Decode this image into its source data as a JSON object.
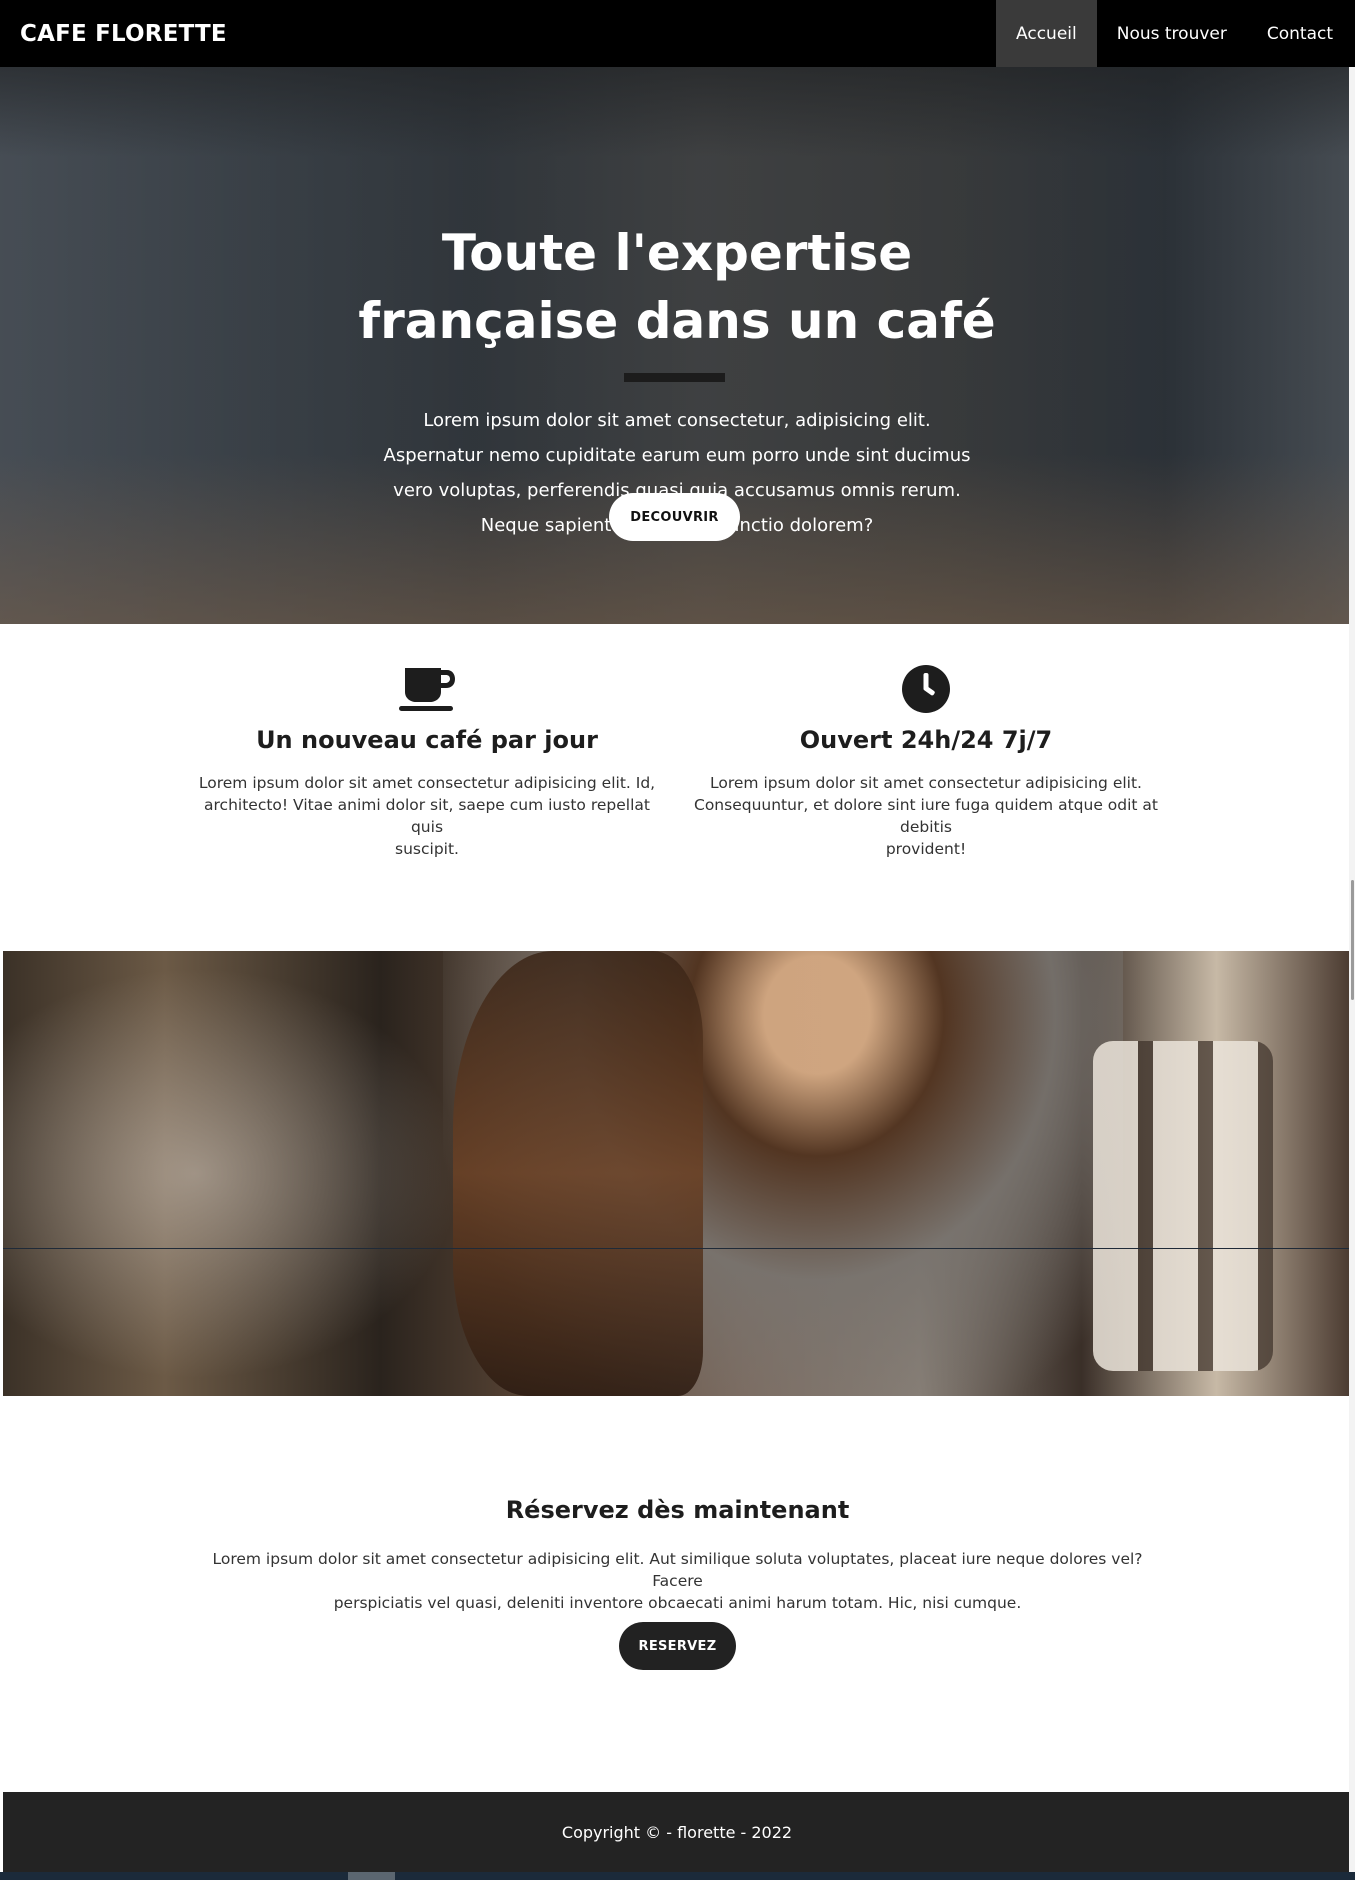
{
  "navbar": {
    "brand": "CAFE FLORETTE",
    "links": [
      {
        "label": "Accueil",
        "active": true
      },
      {
        "label": "Nous trouver",
        "active": false
      },
      {
        "label": "Contact",
        "active": false
      }
    ],
    "background": "#000000",
    "active_background": "#3a3a3a"
  },
  "hero": {
    "title_line1": "Toute l'expertise",
    "title_line2": "française dans un café",
    "text_lines": [
      "Lorem ipsum dolor sit amet consectetur, adipisicing elit.",
      "Aspernatur nemo cupiditate earum eum porro unde sint ducimus",
      "vero voluptas, perferendis quasi quia accusamus omnis rerum.",
      "Neque sapiente quidem distinctio dolorem?"
    ],
    "button_label": "DECOUVRIR"
  },
  "features": [
    {
      "icon": "coffee-cup-icon",
      "title": "Un nouveau café par jour",
      "text_lines": [
        "Lorem ipsum dolor sit amet consectetur adipisicing elit. Id,",
        "architecto! Vitae animi dolor sit, saepe cum iusto repellat quis",
        "suscipit."
      ]
    },
    {
      "icon": "clock-icon",
      "title": "Ouvert 24h/24 7j/7",
      "text_lines": [
        "Lorem ipsum dolor sit amet consectetur adipisicing elit.",
        "Consequuntur, et dolore sint iure fuga quidem atque odit at debitis",
        "provident!"
      ]
    }
  ],
  "reservation": {
    "title": "Réservez dès maintenant",
    "text_lines": [
      "Lorem ipsum dolor sit amet consectetur adipisicing elit. Aut similique soluta voluptates, placeat iure neque dolores vel? Facere",
      "perspiciatis vel quasi, deleniti inventore obcaecati animi harum totam. Hic, nisi cumque."
    ],
    "button_label": "RESERVEZ"
  },
  "footer": {
    "text": "Copyright © - florette - 2022",
    "background": "#232323"
  }
}
